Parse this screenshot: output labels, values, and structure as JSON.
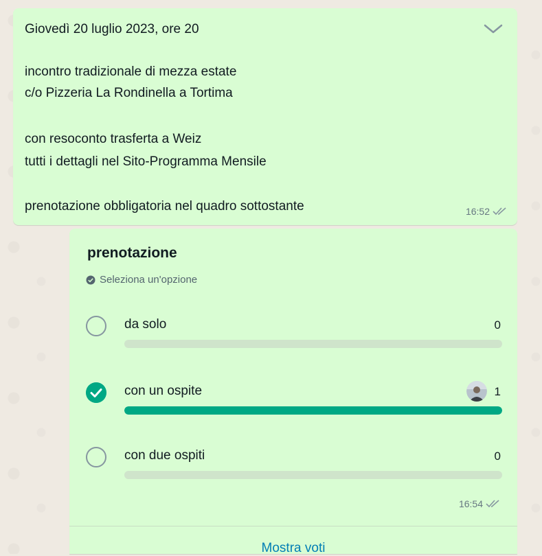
{
  "message": {
    "lines": [
      "Giovedì 20 luglio 2023, ore 20",
      "incontro tradizionale di mezza estate",
      "c/o Pizzeria La Rondinella a Tortima",
      "con resoconto trasferta a Weiz",
      "tutti i dettagli nel Sito-Programma Mensile",
      "prenotazione obbligatoria nel quadro sottostante"
    ],
    "time": "16:52",
    "status_icon": "double-check-icon",
    "menu_icon": "chevron-down-icon"
  },
  "poll": {
    "title": "prenotazione",
    "instruction": "Seleziona un'opzione",
    "instruction_icon": "check-circle-icon",
    "options": [
      {
        "label": "da solo",
        "count": "0",
        "selected": false,
        "fill": 0
      },
      {
        "label": "con un ospite",
        "count": "1",
        "selected": true,
        "fill": 1,
        "voter_icon": "avatar"
      },
      {
        "label": "con due ospiti",
        "count": "0",
        "selected": false,
        "fill": 0
      }
    ],
    "time": "16:54",
    "status_icon": "double-check-icon",
    "show_votes_label": "Mostra voti"
  },
  "colors": {
    "bubble": "#d9fdd3",
    "accent": "#00a884",
    "link": "#027eb5"
  }
}
